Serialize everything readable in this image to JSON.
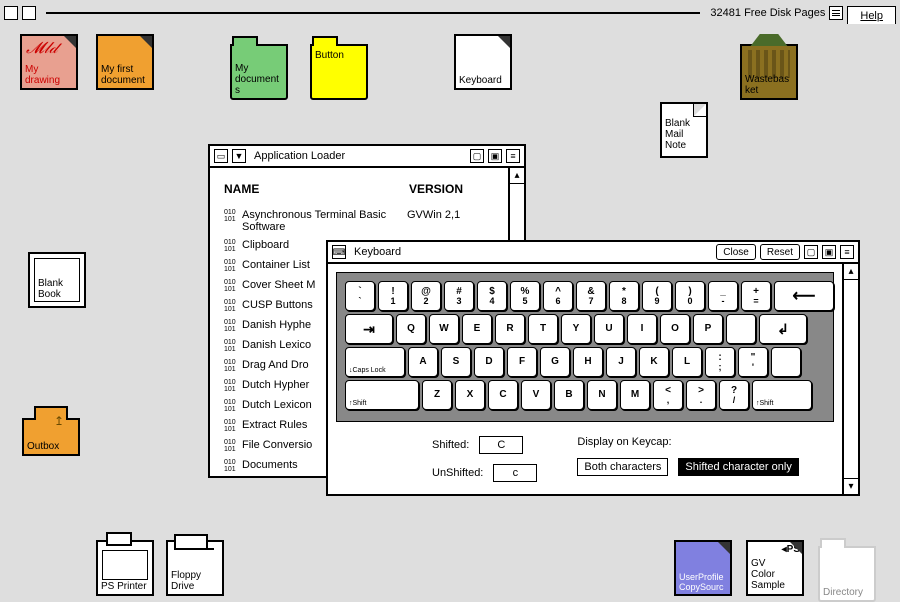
{
  "topbar": {
    "free_pages": "32481 Free Disk Pages",
    "help": "Help"
  },
  "icons": {
    "my_drawing": "My\ndrawing",
    "first_doc": "My first document",
    "my_docs": "My documents",
    "button": "Button",
    "keyboard": "Keyboard",
    "waste": "Wastebasket",
    "mailnote": "Blank\nMail\nNote",
    "blank_book": "Blank\nBook",
    "outbox": "Outbox",
    "ps_printer": "PS Printer",
    "floppy": "Floppy\nDrive",
    "user_profile": "UserProfileCopySourc",
    "gv_color": "GV\nColor\nSample",
    "directory": "Directory"
  },
  "loader": {
    "title": "Application Loader",
    "hdr_name": "NAME",
    "hdr_version": "VERSION",
    "apps": [
      {
        "name": "Asynchronous Terminal Basic Software",
        "ver": "GVWin 2,1"
      },
      {
        "name": "Clipboard",
        "ver": ""
      },
      {
        "name": "Container List",
        "ver": ""
      },
      {
        "name": "Cover Sheet M",
        "ver": ""
      },
      {
        "name": "CUSP Buttons",
        "ver": ""
      },
      {
        "name": "Danish Hyphe",
        "ver": ""
      },
      {
        "name": "Danish Lexico",
        "ver": ""
      },
      {
        "name": "Drag And Dro",
        "ver": ""
      },
      {
        "name": "Dutch Hypher",
        "ver": ""
      },
      {
        "name": "Dutch Lexicon",
        "ver": ""
      },
      {
        "name": "Extract Rules",
        "ver": ""
      },
      {
        "name": "File Conversio",
        "ver": ""
      },
      {
        "name": "Documents",
        "ver": ""
      }
    ]
  },
  "keyboard": {
    "title": "Keyboard",
    "close": "Close",
    "reset": "Reset",
    "shifted_label": "Shifted:",
    "unshifted_label": "UnShifted:",
    "shifted_val": "C",
    "unshifted_val": "c",
    "display_label": "Display on Keycap:",
    "opt_both": "Both characters",
    "opt_shifted": "Shifted character only",
    "rows": {
      "r1": [
        [
          "`",
          "`"
        ],
        [
          "!",
          "1"
        ],
        [
          "@",
          "2"
        ],
        [
          "#",
          "3"
        ],
        [
          "$",
          "4"
        ],
        [
          "%",
          "5"
        ],
        [
          "^",
          "6"
        ],
        [
          "&",
          "7"
        ],
        [
          "*",
          "8"
        ],
        [
          "(",
          "9"
        ],
        [
          ")",
          "0"
        ],
        [
          "_",
          "-"
        ],
        [
          "+",
          "="
        ]
      ],
      "r2": [
        [
          "Q"
        ],
        [
          "W"
        ],
        [
          "E"
        ],
        [
          "R"
        ],
        [
          "T"
        ],
        [
          "Y"
        ],
        [
          "U"
        ],
        [
          "I"
        ],
        [
          "O"
        ],
        [
          "P"
        ],
        [
          "",
          ""
        ]
      ],
      "r3": [
        [
          "A"
        ],
        [
          "S"
        ],
        [
          "D"
        ],
        [
          "F"
        ],
        [
          "G"
        ],
        [
          "H"
        ],
        [
          "J"
        ],
        [
          "K"
        ],
        [
          "L"
        ],
        [
          ":",
          ";"
        ],
        [
          "\"",
          "'"
        ]
      ],
      "r4": [
        [
          "Z"
        ],
        [
          "X"
        ],
        [
          "C"
        ],
        [
          "V"
        ],
        [
          "B"
        ],
        [
          "N"
        ],
        [
          "M"
        ],
        [
          "<",
          ","
        ],
        [
          ">",
          "."
        ],
        [
          "?",
          "/"
        ]
      ]
    },
    "mods": {
      "capslock": "Caps Lock",
      "shift": "Shift"
    }
  }
}
